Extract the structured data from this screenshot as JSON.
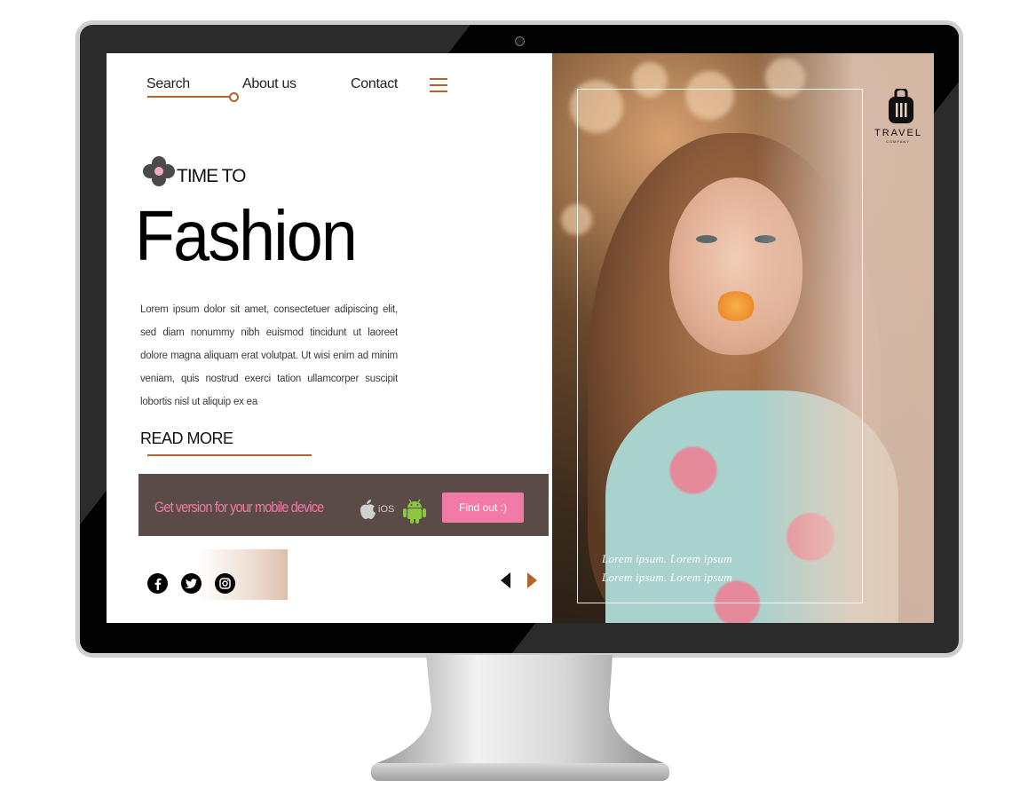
{
  "nav": {
    "items": [
      {
        "label": "Search"
      },
      {
        "label": "About us"
      },
      {
        "label": "Contact"
      }
    ]
  },
  "hero": {
    "eyebrow": "TIME TO",
    "headline": "Fashion",
    "body": "Lorem ipsum dolor sit amet, consectetuer adipiscing elit, sed diam nonummy nibh euismod tincidunt ut laoreet dolore magna aliquam erat volutpat. Ut wisi enim ad minim veniam, quis nostrud exerci tation ullamcorper suscipit lobortis nisl ut aliquip ex ea",
    "read_more": "READ MORE"
  },
  "banner": {
    "text": "Get version for your mobile device",
    "ios_label": "iOS",
    "button": "Find out :)"
  },
  "photo": {
    "captions": [
      "Lorem ipsum. Lorem ipsum",
      "Lorem ipsum. Lorem ipsum"
    ]
  },
  "logo": {
    "name": "TRAVEL",
    "sub": "COMPANY"
  },
  "colors": {
    "accent": "#b3642c",
    "banner_bg": "#5a4b47",
    "pink": "#f37aa6",
    "screen_bg": "#ffffff"
  },
  "icons": [
    "menu-icon",
    "flower-icon",
    "apple-icon",
    "android-icon",
    "facebook-icon",
    "twitter-icon",
    "instagram-icon",
    "luggage-icon",
    "arrow-left-icon",
    "arrow-right-icon"
  ]
}
